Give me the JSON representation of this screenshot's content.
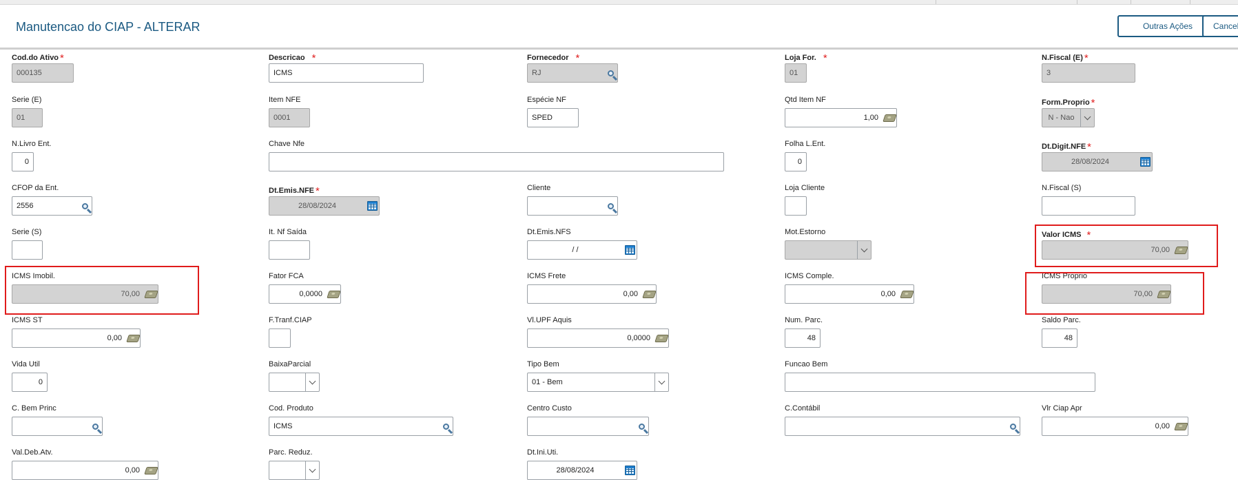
{
  "header": {
    "title": "Manutencao do CIAP - ALTERAR",
    "other_actions_label": "Outras Ações",
    "cancel_label": "Cancelar"
  },
  "colors": {
    "accent": "#1b5a82",
    "required_star": "#e02020",
    "highlight": "#e01b1b",
    "readonly_bg": "#d3d3d3"
  },
  "fields": {
    "cod_ativo": {
      "label": "Cod.do Ativo",
      "value": "000135"
    },
    "descricao": {
      "label": "Descricao",
      "value": "ICMS"
    },
    "fornecedor": {
      "label": "Fornecedor",
      "value": "RJ"
    },
    "loja_for": {
      "label": "Loja For.",
      "value": "01"
    },
    "nfiscal_e": {
      "label": "N.Fiscal (E)",
      "value": "3"
    },
    "serie_e": {
      "label": "Serie (E)",
      "value": "01"
    },
    "item_nfe": {
      "label": "Item NFE",
      "value": "0001"
    },
    "especie_nf": {
      "label": "Espécie NF",
      "value": "SPED"
    },
    "qtd_item_nf": {
      "label": "Qtd Item NF",
      "value": "1,00"
    },
    "form_proprio": {
      "label": "Form.Proprio",
      "value": "N - Nao"
    },
    "nlivro_ent": {
      "label": "N.Livro Ent.",
      "value": "0"
    },
    "chave_nfe": {
      "label": "Chave Nfe",
      "value": ""
    },
    "folha_lent": {
      "label": "Folha L.Ent.",
      "value": "0"
    },
    "dt_digit_nfe": {
      "label": "Dt.Digit.NFE",
      "value": "28/08/2024"
    },
    "cfop_ent": {
      "label": "CFOP da Ent.",
      "value": "2556"
    },
    "dt_emis_nfe": {
      "label": "Dt.Emis.NFE",
      "value": "28/08/2024"
    },
    "cliente": {
      "label": "Cliente",
      "value": ""
    },
    "loja_cliente": {
      "label": "Loja Cliente",
      "value": ""
    },
    "nfiscal_s": {
      "label": "N.Fiscal (S)",
      "value": ""
    },
    "serie_s": {
      "label": "Serie (S)",
      "value": ""
    },
    "it_nf_saida": {
      "label": "It. Nf Saída",
      "value": ""
    },
    "dt_emis_nfs": {
      "label": "Dt.Emis.NFS",
      "value": " /  /"
    },
    "mot_estorno": {
      "label": "Mot.Estorno",
      "value": ""
    },
    "valor_icms": {
      "label": "Valor ICMS",
      "value": "70,00"
    },
    "icms_imobil": {
      "label": "ICMS Imobil.",
      "value": "70,00"
    },
    "fator_fca": {
      "label": "Fator FCA",
      "value": "0,0000"
    },
    "icms_frete": {
      "label": "ICMS Frete",
      "value": "0,00"
    },
    "icms_comple": {
      "label": "ICMS Comple.",
      "value": "0,00"
    },
    "icms_proprio": {
      "label": "ICMS Proprio",
      "value": "70,00"
    },
    "icms_st": {
      "label": "ICMS ST",
      "value": "0,00"
    },
    "ftranf_ciap": {
      "label": "F.Tranf.CIAP",
      "value": ""
    },
    "vl_upf_aquis": {
      "label": "Vl.UPF Aquis",
      "value": "0,0000"
    },
    "num_parc": {
      "label": "Num. Parc.",
      "value": "48"
    },
    "saldo_parc": {
      "label": "Saldo Parc.",
      "value": "48"
    },
    "vida_util": {
      "label": "Vida Util",
      "value": "0"
    },
    "baixa_parcial": {
      "label": "BaixaParcial",
      "value": ""
    },
    "tipo_bem": {
      "label": "Tipo Bem",
      "value": "01 - Bem"
    },
    "funcao_bem": {
      "label": "Funcao Bem",
      "value": ""
    },
    "c_bem_princ": {
      "label": "C. Bem Princ",
      "value": ""
    },
    "cod_produto": {
      "label": "Cod. Produto",
      "value": "ICMS"
    },
    "centro_custo": {
      "label": "Centro Custo",
      "value": ""
    },
    "c_contabil": {
      "label": "C.Contábil",
      "value": ""
    },
    "vlr_ciap_apr": {
      "label": "Vlr Ciap Apr",
      "value": "0,00"
    },
    "val_deb_atv": {
      "label": "Val.Deb.Atv.",
      "value": "0,00"
    },
    "parc_reduz": {
      "label": "Parc. Reduz.",
      "value": ""
    },
    "dt_ini_uti": {
      "label": "Dt.Ini.Uti.",
      "value": "28/08/2024"
    }
  }
}
